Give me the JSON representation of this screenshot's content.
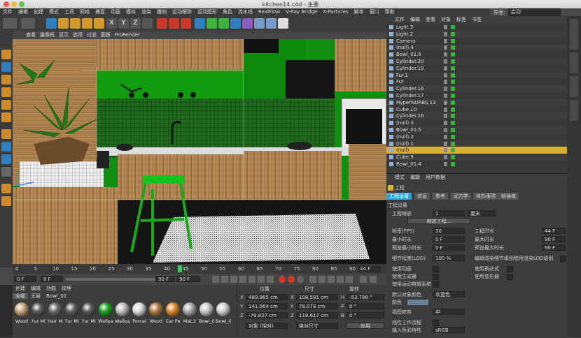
{
  "window": {
    "title": "kitchen14.c4d - 主要"
  },
  "menubar": [
    "文件",
    "编辑",
    "创建",
    "模式",
    "工具",
    "网格",
    "捕捉",
    "动画",
    "模拟",
    "渲染",
    "雕刻",
    "运动跟踪",
    "运动图形",
    "角色",
    "流水线",
    "RealFlow",
    "V-Ray Bridge",
    "X-Particles",
    "脚本",
    "窗口",
    "帮助"
  ],
  "layout": {
    "label": "界面:",
    "value": "启动"
  },
  "viewport": {
    "menu": [
      "查看",
      "摄像机",
      "显示",
      "选项",
      "过滤",
      "面板",
      "ProRender"
    ]
  },
  "timeline": {
    "ticks": [
      "0",
      "5",
      "10",
      "15",
      "20",
      "25",
      "30",
      "35",
      "40",
      "45",
      "50",
      "55",
      "60",
      "65",
      "70",
      "75",
      "80",
      "85",
      "90"
    ],
    "current": "44",
    "end_label": "44 F"
  },
  "transport": {
    "start": "0 F",
    "min": "0 F",
    "max": "90 F",
    "end": "90 F"
  },
  "materials": {
    "menu": [
      "创建",
      "编辑",
      "功能",
      "纹理"
    ],
    "filters": [
      "全部",
      "无层",
      "Bowl_01"
    ],
    "items": [
      "Wood",
      "Fur Mi",
      "Hair Ma",
      "Fur Mi",
      "Fur Mi",
      "Wallpa",
      "Wallpa",
      "Porcel",
      "Wood",
      "Car Pa",
      "Mat.2",
      "Bowl_0",
      "Bowl_0"
    ]
  },
  "coordinates": {
    "headers": {
      "position": "位置",
      "size": "尺寸",
      "rotation": "旋转"
    },
    "rows": [
      {
        "a": "X",
        "pos": "489.965 cm",
        "b": "X",
        "size": "108.591 cm",
        "c": "H",
        "rot": "-53.788 °"
      },
      {
        "a": "Y",
        "pos": "141.564 cm",
        "b": "Y",
        "size": "78.078 cm",
        "c": "P",
        "rot": "0 °"
      },
      {
        "a": "Z",
        "pos": "-79.827 cm",
        "b": "Z",
        "size": "119.617 cm",
        "c": "B",
        "rot": "0 °"
      }
    ],
    "mode": "对象 (相对)",
    "sizemode": "绝对尺寸",
    "apply": "应用"
  },
  "object_manager": {
    "menu": [
      "文件",
      "编辑",
      "查看",
      "对象",
      "标签",
      "书签"
    ],
    "objects": [
      "Light.3",
      "Light.2",
      "Camera",
      "(null).4",
      "Bowl_01.6",
      "Cylinder.20",
      "Cylinder.19",
      "Fur.1",
      "Fur",
      "Cylinder.18",
      "Cylinder.17",
      "HyperNURBS.13",
      "Cube.10",
      "Cylinder.16",
      "(null).3",
      "Bowl_01.5",
      "(null).2",
      "(null).1",
      "(null)",
      "Cube.9",
      "Bowl_01.4"
    ]
  },
  "attributes": {
    "menu": [
      "模式",
      "编辑",
      "用户数据"
    ],
    "title": "工程",
    "tabs": [
      "工程设置",
      "信息",
      "参考",
      "动力学",
      "待办事项",
      "帧插值"
    ],
    "section": "工程设置",
    "scale_label": "工程缩放",
    "scale_value": "1",
    "scale_unit": "厘米",
    "scale_button": "缩放工程...",
    "left_fields": [
      {
        "label": "帧率(FPS)",
        "value": "30"
      },
      {
        "label": "最小时长",
        "value": "0 F"
      },
      {
        "label": "预览最小时长",
        "value": "0 F"
      },
      {
        "label": "细节程度(LOD)",
        "value": "100 %"
      }
    ],
    "right_fields": [
      {
        "label": "工程时长",
        "value": "44 F"
      },
      {
        "label": "最大时长",
        "value": "90 F"
      },
      {
        "label": "预览最大时长",
        "value": "90 F"
      }
    ],
    "lod_check": "编辑渲染细节级别使用渲染LOD级别",
    "checks_left": [
      "使用动画",
      "使用生成器",
      "使用运动剪辑系统"
    ],
    "checks_right": [
      "使用表达式",
      "使用变形器"
    ],
    "default_color_label": "默认对象颜色",
    "default_color_value": "灰蓝色",
    "color_label": "颜色",
    "view_correct_label": "视图修剪",
    "view_correct_value": "中",
    "linear_label": "线性工作流程",
    "input_color_label": "输入色彩特性",
    "input_color_value": "sRGB"
  },
  "colors": {
    "accent": "#2fa0e0",
    "grass": "#13b313",
    "selected": "#d8b13a"
  }
}
